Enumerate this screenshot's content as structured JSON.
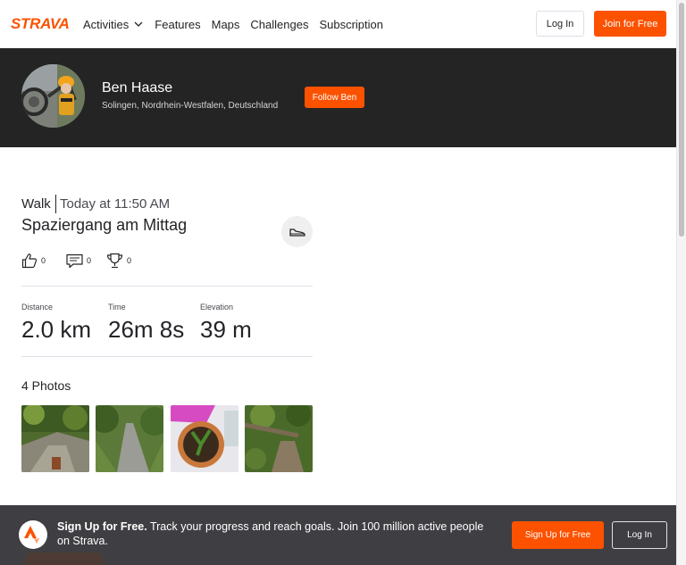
{
  "nav": {
    "logo": "STRAVA",
    "links": [
      "Activities",
      "Features",
      "Maps",
      "Challenges",
      "Subscription"
    ],
    "login_label": "Log In",
    "join_label": "Join for Free"
  },
  "athlete": {
    "name": "Ben Haase",
    "location": "Solingen, Nordrhein-Westfalen, Deutschland",
    "follow_label": "Follow Ben"
  },
  "activity": {
    "type": "Walk",
    "time": "Today at 11:50 AM",
    "title": "Spaziergang am Mittag",
    "sport_icon": "shoe-icon",
    "kudos_count": "0",
    "comments_count": "0",
    "achievements_count": "0",
    "stats": [
      {
        "label": "Distance",
        "value": "2.0 km"
      },
      {
        "label": "Time",
        "value": "26m 8s"
      },
      {
        "label": "Elevation",
        "value": "39 m"
      }
    ],
    "photos_title": "4 Photos"
  },
  "signup": {
    "headline": "Sign Up for Free.",
    "text": " Track your progress and reach goals. Join 100 million active people on Strava.",
    "signup_label": "Sign Up for Free",
    "login_label": "Log In"
  },
  "colors": {
    "brand": "#fc5200",
    "header_bg": "#242424",
    "footer_bg": "#3f3f43"
  }
}
